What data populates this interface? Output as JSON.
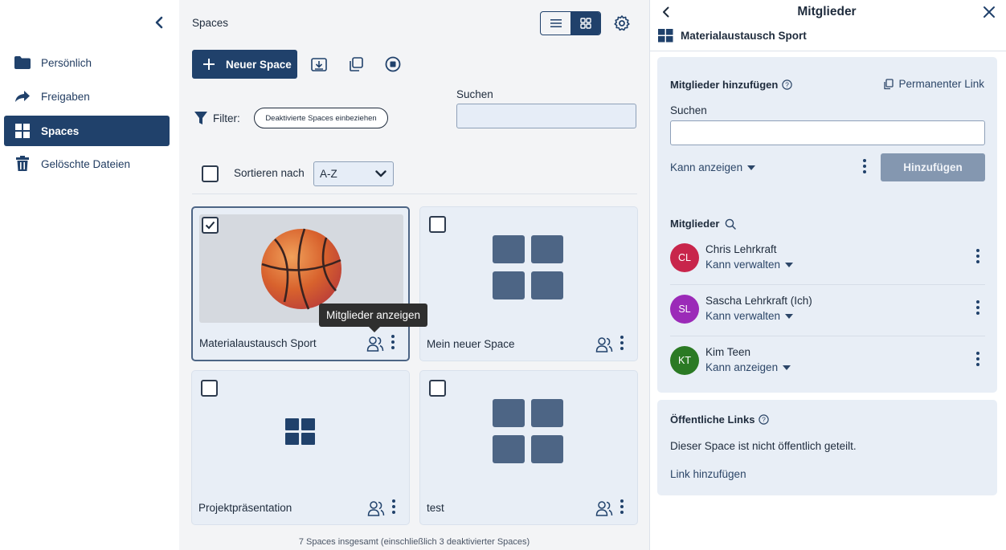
{
  "sidebar": {
    "items": [
      {
        "label": "Persönlich",
        "icon": "folder-icon"
      },
      {
        "label": "Freigaben",
        "icon": "share-icon"
      },
      {
        "label": "Spaces",
        "icon": "spaces-grid-icon",
        "active": true
      },
      {
        "label": "Gelöschte Dateien",
        "icon": "trash-icon"
      }
    ]
  },
  "main": {
    "title": "Spaces",
    "new_space_label": "Neuer Space",
    "filter_label": "Filter:",
    "filter_pill": "Deaktivierte Spaces einbeziehen",
    "search_label": "Suchen",
    "sort_label": "Sortieren nach",
    "sort_value": "A-Z",
    "cards": [
      {
        "name": "Materialaustausch Sport",
        "selected": true,
        "thumbnail": "basketball-image"
      },
      {
        "name": "Mein neuer Space",
        "selected": false,
        "thumbnail": "spaces-grid-icon"
      },
      {
        "name": "Projektpräsentation",
        "selected": false,
        "thumbnail": "spaces-grid-icon"
      },
      {
        "name": "test",
        "selected": false,
        "thumbnail": "spaces-grid-icon"
      }
    ],
    "tooltip": "Mitglieder anzeigen",
    "footer": "7 Spaces insgesamt (einschließlich 3 deaktivierter Spaces)"
  },
  "panel": {
    "title": "Mitglieder",
    "space_name": "Materialaustausch Sport",
    "add_members_title": "Mitglieder hinzufügen",
    "permanent_link": "Permanenter Link",
    "search_label": "Suchen",
    "role_select": "Kann anzeigen",
    "add_button": "Hinzufügen",
    "members_title": "Mitglieder",
    "members": [
      {
        "initials": "CL",
        "name": "Chris Lehrkraft",
        "role": "Kann verwalten",
        "color": "#c8254b"
      },
      {
        "initials": "SL",
        "name": "Sascha Lehrkraft (Ich)",
        "role": "Kann verwalten",
        "color": "#9b2ab8"
      },
      {
        "initials": "KT",
        "name": "Kim Teen",
        "role": "Kann anzeigen",
        "color": "#2b7a24"
      }
    ],
    "public_links_title": "Öffentliche Links",
    "public_links_text": "Dieser Space ist nicht öffentlich geteilt.",
    "add_link": "Link hinzufügen"
  },
  "colors": {
    "primary": "#20416b",
    "card_bg": "#e8eef6",
    "panel_bg": "#e8eef6"
  }
}
